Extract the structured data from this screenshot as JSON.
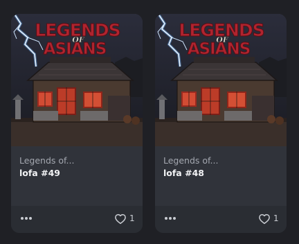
{
  "cards": [
    {
      "collection": "Legends of...",
      "title": "lofa #49",
      "likes": "1",
      "artwork": {
        "logo_line1": "LEGENDS",
        "logo_line2": "OF",
        "logo_line3": "ASIANS",
        "logo_color": "#b0242f",
        "description": "pixel-art Japanese wooden house at night with lightning"
      },
      "more_icon": "more-horizontal-icon",
      "like_icon": "heart-outline-icon"
    },
    {
      "collection": "Legends of...",
      "title": "lofa #48",
      "likes": "1",
      "artwork": {
        "logo_line1": "LEGENDS",
        "logo_line2": "OF",
        "logo_line3": "ASIANS",
        "logo_color": "#b0242f",
        "description": "pixel-art Japanese wooden house at night with lightning"
      },
      "more_icon": "more-horizontal-icon",
      "like_icon": "heart-outline-icon"
    }
  ],
  "colors": {
    "background": "#1f2025",
    "card": "#30333a",
    "footer": "#2a2d33",
    "muted_text": "#a4a8b0",
    "title_text": "#f2f3f5"
  }
}
